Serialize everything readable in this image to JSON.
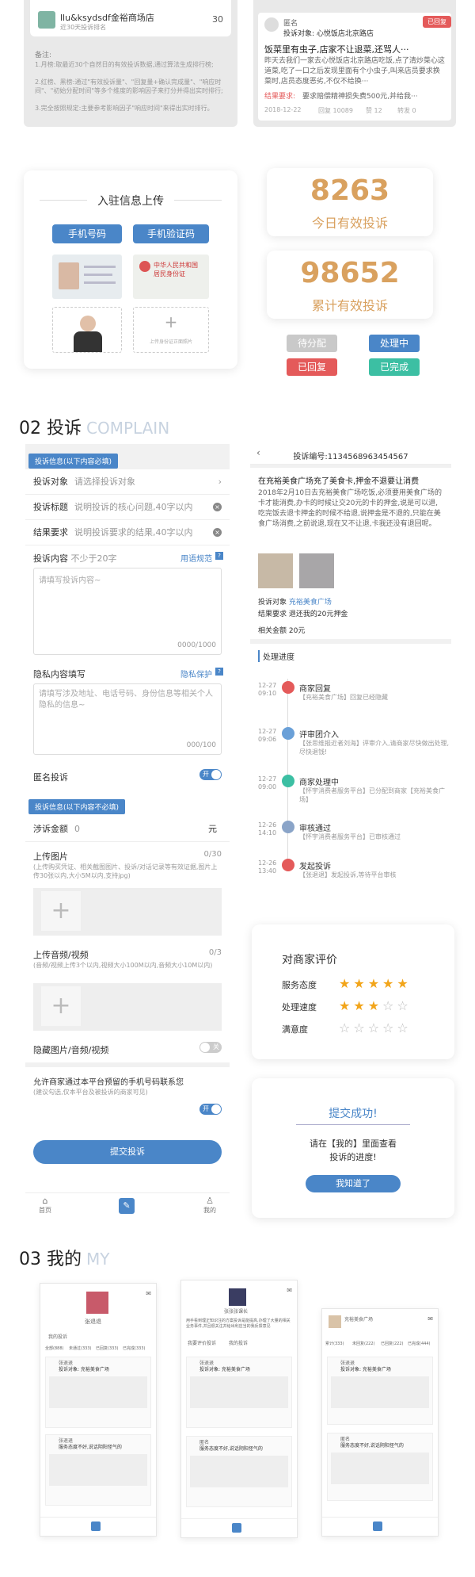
{
  "top": {
    "store_name": "llu&ksydsdf金裕商场店",
    "store_sub": "近30天投诉排名",
    "store_count": "30",
    "notes_title": "备注:",
    "notes": [
      "1.月榜:取最近30个自然日的有效投诉数据,通过算法生成排行榜;",
      "2.红榜、黑榜:通过\"有效投诉量\"、\"回复量+确认完成量\"、\"响应时间\"、\"初始分配时间\"等多个维度的影响因子来打分并得出实时排行;",
      "3.完全按照规定:主要参考影响因子\"响应时间\"来得出实时排行。"
    ],
    "complaint": {
      "name": "匿名",
      "status": "已回复",
      "target": "投诉对象: 心悦饭店北京路店",
      "title": "饭菜里有虫子,店家不让退菜,还骂人···",
      "body": "昨天去我们一家去心悦饭店北京路店吃饭,点了清炒菜心这道菜,吃了一口之后发现里面有个小虫子,叫来店员要求换菜时,店员态度恶劣,不仅不给换···",
      "req_label": "结果要求:",
      "req": "要求赔偿精神损失费500元,并给我···",
      "date": "2018-12-22",
      "views": "回复 10089",
      "likes": "赞 12",
      "shares": "转发 0"
    }
  },
  "upload": {
    "title": "入驻信息上传",
    "btn_phone": "手机号码",
    "btn_code": "手机验证码",
    "id_front": "中华人民共和国 居民身份证",
    "add_hint": "上传身份证正面照片"
  },
  "stats": {
    "today_num": "8263",
    "today_label": "今日有效投诉",
    "total_num": "98652",
    "total_label": "累计有效投诉",
    "tags": [
      "待分配",
      "处理中",
      "已回复",
      "已完成"
    ],
    "colors": {
      "orange": "#d9a15f",
      "pending": "#c9c9c9",
      "processing": "#4a86c8",
      "replied": "#e45a5a",
      "done": "#3cbfa3"
    }
  },
  "sec2": {
    "num": "02 投诉",
    "en": "COMPLAIN"
  },
  "form": {
    "must_title": "投诉信息(以下内容必填)",
    "rows": [
      {
        "label": "投诉对象",
        "ph": "请选择投诉对象"
      },
      {
        "label": "投诉标题",
        "ph": "说明投诉的核心问题,40字以内"
      },
      {
        "label": "结果要求",
        "ph": "说明投诉要求的结果,40字以内"
      }
    ],
    "content_label": "投诉内容",
    "content_hint": "不少于20字",
    "content_link": "用语规范",
    "content_ph": "请填写投诉内容~",
    "content_count": "0000/1000",
    "privacy_label": "隐私内容填写",
    "privacy_link": "隐私保护",
    "privacy_ph": "请填写涉及地址、电话号码、身份信息等相关个人隐私的信息~",
    "privacy_count": "000/100",
    "anon_label": "匿名投诉",
    "anon_toggle": "开",
    "opt_title": "投诉信息(以下内容不必填)",
    "amount_label": "涉诉金额",
    "amount_val": "0",
    "amount_unit": "元",
    "upimg_label": "上传图片",
    "upimg_count": "0/30",
    "upimg_hint": "(上传购买凭证、相关截图图片、投诉/对话记录等有效证据,图片上传30张以内,大小5M以内,支持jpg)",
    "upvid_label": "上传音频/视频",
    "upvid_count": "0/3",
    "upvid_hint": "(音频/视频上传3个以内,视频大小100M以内,音频大小10M以内)",
    "hide_label": "隐藏图片/音频/视频",
    "hide_toggle": "关",
    "allow_label": "允许商家通过本平台预留的手机号码联系您",
    "allow_hint": "(建议勾选,仅本平台及被投诉的商家可见)",
    "allow_toggle": "开",
    "submit": "提交投诉",
    "nav": [
      "首页",
      "",
      "我的"
    ]
  },
  "detail": {
    "header": "投诉编号:1134568963454567",
    "title": "在充裕美食广场充了美食卡,押金不退要让消费",
    "body": "2018年2月10日去充裕美食广场吃饭,必须要用美食广场的卡才能消费,办卡的时候让交20元的卡的押金,说是可以退,吃完饭去退卡押金的时候不给退,说押金是不退的,只能在美食广场消费,之前说退,现在又不让退,卡我还没有退回呢。",
    "target_label": "投诉对象",
    "target_val": "充裕美食广场",
    "req_label": "结果要求",
    "req_val": "退还我的20元押金",
    "amount_label": "相关金额",
    "amount_val": "20元",
    "progress_title": "处理进度",
    "timeline": [
      {
        "date": "12-27 09:10",
        "title": "商家回复",
        "sub": "【充裕美食广场】回复已经隐藏",
        "color": "#e45a5a"
      },
      {
        "date": "12-27 09:06",
        "title": "评审团介入",
        "sub": "【张思维报近者刘海】评审介入,请商家尽快做出处理,尽快退钱!",
        "color": "#6aa0d8"
      },
      {
        "date": "12-27 09:00",
        "title": "商家处理中",
        "sub": "【怀宇消费者服务平台】已分配到商家【充裕美食广场】",
        "color": "#3cbfa3"
      },
      {
        "date": "12-26 14:10",
        "title": "审核通过",
        "sub": "【怀宇消费者服务平台】已审核通过",
        "color": "#8aa4c8"
      },
      {
        "date": "12-26 13:40",
        "title": "发起投诉",
        "sub": "【张退退】发起投诉,等待平台审核",
        "color": "#e45a5a"
      }
    ]
  },
  "rating": {
    "title": "对商家评价",
    "rows": [
      {
        "label": "服务态度",
        "stars": 5
      },
      {
        "label": "处理速度",
        "stars": 3
      },
      {
        "label": "满意度",
        "stars": 0
      }
    ]
  },
  "success": {
    "title": "提交成功!",
    "line1": "请在【我的】里面查看",
    "line2": "投诉的进度!",
    "btn": "我知道了"
  },
  "sec3": {
    "num": "03 我的",
    "en": "MY"
  },
  "mine": {
    "p1": {
      "name": "张退退",
      "tabs": [
        "我的投诉"
      ],
      "sub": [
        "全部(888)",
        "未通过(333)",
        "已回复(333)",
        "已完成(333)"
      ]
    },
    "p2": {
      "name": "张张张课长",
      "tabs": [
        "我要评价投诉",
        "我的投诉"
      ],
      "intro": "用手看到理正知识注的方案投诉是能提高,办理了大量的相关业务事件,并且很关注并给出利应当的我反馈意见"
    },
    "p3": {
      "name": "充裕美食广场",
      "stats": [
        "累计(333)",
        "未回复(222)",
        "已回复(222)",
        "已完成(444)"
      ]
    },
    "item_title": "投诉对象: 充裕美食广场",
    "item_title2": "服务态度不好,说话阴阳怪气的",
    "user": "张退退",
    "user2": "匿名",
    "nav": [
      "首页",
      "",
      "我的"
    ]
  }
}
